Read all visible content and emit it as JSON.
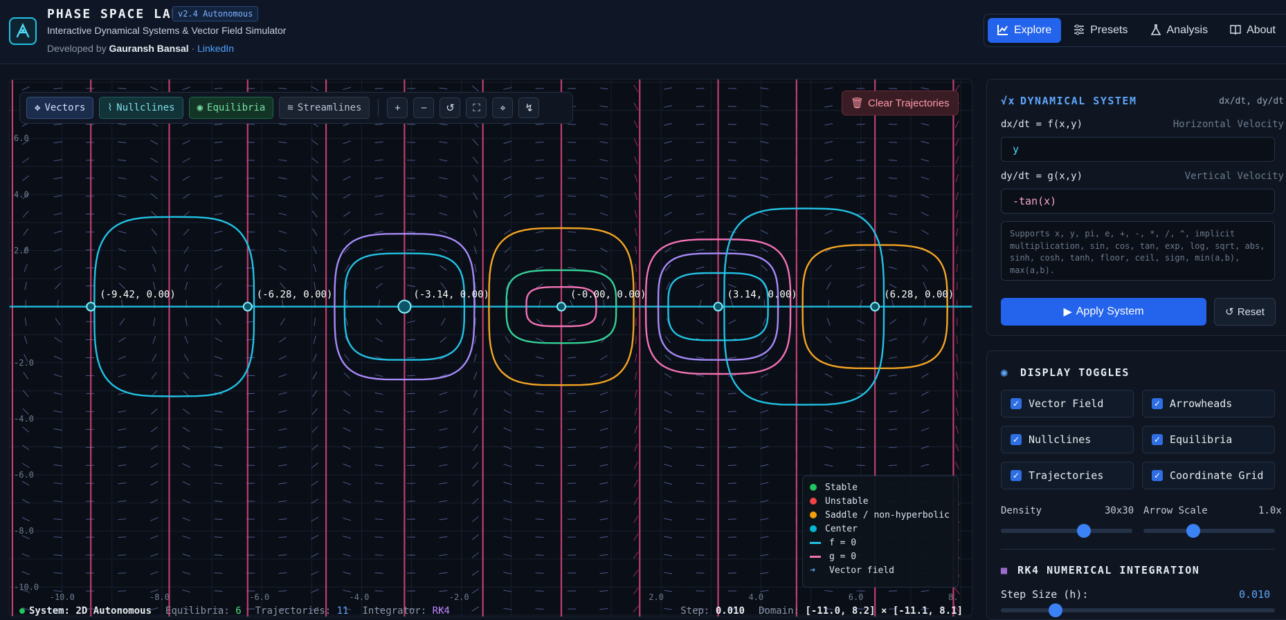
{
  "header": {
    "logo_icon": "atom-pen-icon",
    "title": "PHASE SPACE LAB",
    "version": "v2.4 Autonomous",
    "subtitle": "Interactive Dynamical Systems & Vector Field Simulator",
    "credits_prefix": "Developed by",
    "author": "Gauransh Bansal",
    "credits_sep": "·",
    "link": "LinkedIn"
  },
  "nav": {
    "tabs": [
      {
        "label": "Explore",
        "icon": "chart-line-icon",
        "active": true
      },
      {
        "label": "Presets",
        "icon": "sliders-icon",
        "active": false
      },
      {
        "label": "Analysis",
        "icon": "flask-icon",
        "active": false
      },
      {
        "label": "About",
        "icon": "book-icon",
        "active": false
      }
    ]
  },
  "toolbar": {
    "vectors": "Vectors",
    "nullclines": "Nullclines",
    "equilibria": "Equilibria",
    "streamlines": "Streamlines",
    "tools": [
      "zoom-in-icon",
      "zoom-out-icon",
      "undo-icon",
      "fullscreen-icon",
      "crosshair-icon",
      "trajectory-tool-icon"
    ],
    "clear": "Clear Trajectories"
  },
  "plot": {
    "y_ticks": [
      "6.0",
      "4.0",
      "2.0",
      "-2.0",
      "-4.0",
      "-6.0",
      "-8.0",
      "-10.0"
    ],
    "x_ticks": [
      "-10.0",
      "-8.0",
      "-6.0",
      "-4.0",
      "-2.0",
      "2.0",
      "4.0",
      "6.0",
      "8."
    ],
    "equilibrium_labels": [
      "(-9.42, 0.00)",
      "(-6.28, 0.00)",
      "(-3.14, 0.00)",
      "(-0.00, 0.00)",
      "(3.14, 0.00)",
      "(6.28, 0.00)"
    ],
    "colors": {
      "f_nullcline": "#1fb8d8",
      "g_nullcline": "#e0467f",
      "vector": "#b83a6a",
      "purple": "#a78bfa",
      "yellow": "#f5a623",
      "green": "#34d399",
      "pink": "#f472b6",
      "cyan": "#22c3e6"
    }
  },
  "legend": {
    "items": [
      {
        "label": "Stable",
        "color": "#22c55e"
      },
      {
        "label": "Unstable",
        "color": "#ef4444"
      },
      {
        "label": "Saddle / non-hyperbolic",
        "color": "#f59e0b"
      },
      {
        "label": "Center",
        "color": "#06b6d4"
      },
      {
        "label": "f = 0",
        "color": "#22c3e6"
      },
      {
        "label": "g = 0",
        "color": "#f472b6"
      },
      {
        "label": "Vector field",
        "color": "#60a5fa"
      }
    ]
  },
  "status": {
    "system_label": "System:",
    "system": "2D Autonomous",
    "eq_label": "Equilibria:",
    "eq": "6",
    "traj_label": "Trajectories:",
    "traj": "11",
    "int_label": "Integrator:",
    "int": "RK4",
    "step_label": "Step:",
    "step": "0.010",
    "domain_label": "Domain:",
    "domain": "[-11.0, 8.2] × [-11.1, 8.1]"
  },
  "system_panel": {
    "title": "DYNAMICAL SYSTEM",
    "title_icon": "sqrt-icon",
    "vars": "dx/dt, dy/dt",
    "f_label": "dx/dt = f(x,y)",
    "f_hint": "Horizontal Velocity",
    "f_value": "y",
    "g_label": "dy/dt = g(x,y)",
    "g_hint": "Vertical Velocity",
    "g_value": "-tan(x)",
    "syntax": "Supports x, y, pi, e, +, -, *, /, ^, implicit multiplication, sin, cos, tan, exp, log, sqrt, abs, sinh, cosh, tanh, floor, ceil, sign, min(a,b), max(a,b).",
    "apply": "Apply System",
    "reset": "Reset"
  },
  "display_panel": {
    "title": "DISPLAY TOGGLES",
    "title_icon": "eye-icon",
    "toggles": [
      {
        "label": "Vector Field",
        "checked": true
      },
      {
        "label": "Arrowheads",
        "checked": true
      },
      {
        "label": "Nullclines",
        "checked": true
      },
      {
        "label": "Equilibria",
        "checked": true
      },
      {
        "label": "Trajectories",
        "checked": true
      },
      {
        "label": "Coordinate Grid",
        "checked": true
      }
    ],
    "density_label": "Density",
    "density": "30x30",
    "density_level": 0.63,
    "arrow_label": "Arrow Scale",
    "arrow": "1.0x",
    "arrow_level": 0.38,
    "rk4_title": "RK4 NUMERICAL INTEGRATION",
    "rk4_icon": "calculator-icon",
    "step_label": "Step Size (h):",
    "step": "0.010",
    "step_level": 0.2
  }
}
